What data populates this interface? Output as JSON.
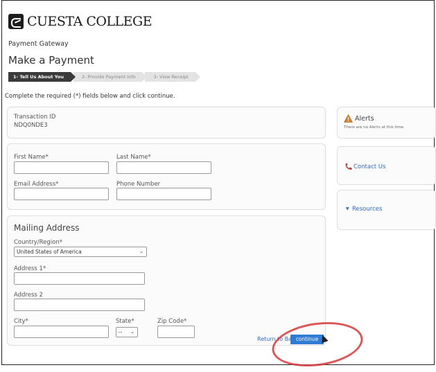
{
  "brand": {
    "name": "CUESTA COLLEGE"
  },
  "header": {
    "gateway": "Payment Gateway",
    "title": "Make a Payment"
  },
  "steps": [
    {
      "label": "1- Tell Us About You"
    },
    {
      "label": "2- Provide Payment Info"
    },
    {
      "label": "3- View Receipt"
    }
  ],
  "instructions": "Complete the required (*) fields below and click continue.",
  "transaction": {
    "label": "Transaction ID",
    "value": "NDQ0NDE3"
  },
  "contact": {
    "first_name_label": "First Name*",
    "last_name_label": "Last Name*",
    "email_label": "Email Address*",
    "phone_label": "Phone Number"
  },
  "mailing": {
    "title": "Mailing Address",
    "country_label": "Country/Region*",
    "country_value": "United States of America",
    "address1_label": "Address 1*",
    "address2_label": "Address 2",
    "city_label": "City*",
    "state_label": "State*",
    "state_value": "--",
    "zip_label": "Zip Code*"
  },
  "sidebar": {
    "alerts_title": "Alerts",
    "alerts_text": "There are no Alerts at this time.",
    "contact_label": "Contact Us",
    "resources_label": "Resources"
  },
  "footer": {
    "return_label": "Return to Banner",
    "continue_label": "continue"
  },
  "colors": {
    "link": "#2b6cc4",
    "button": "#2f7bd6",
    "annotation": "#d63a3a"
  }
}
